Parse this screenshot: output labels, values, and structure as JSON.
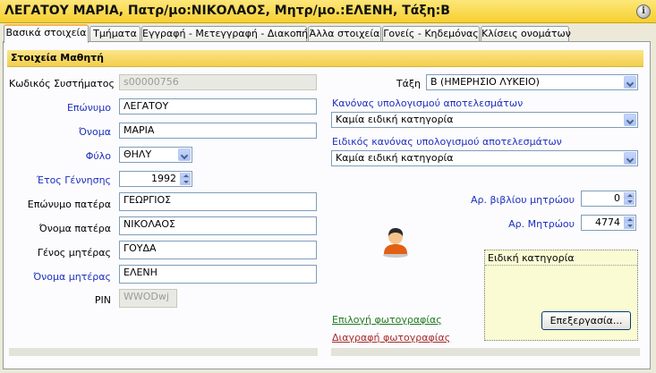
{
  "window": {
    "title": "ΛΕΓΑΤΟΥ ΜΑΡΙΑ, Πατρ/μο:ΝΙΚΟΛΑΟΣ, Μητρ/μο.:ΕΛΕΝΗ, Τάξη:Β",
    "info_icon": "info-icon"
  },
  "tabs": [
    {
      "label": "Βασικά στοιχεία",
      "active": true
    },
    {
      "label": "Τμήματα"
    },
    {
      "label": "Εγγραφή - Μετεγγραφή - Διακοπή"
    },
    {
      "label": "Άλλα στοιχεία"
    },
    {
      "label": "Γονείς - Κηδεμόνας"
    },
    {
      "label": "Κλίσεις ονομάτων"
    }
  ],
  "section": {
    "title": "Στοιχεία Μαθητή"
  },
  "form": {
    "system_code": {
      "label": "Κωδικός Συστήματος",
      "value": "s00000756"
    },
    "surname": {
      "label": "Επώνυμο",
      "value": "ΛΕΓΑΤΟΥ"
    },
    "name": {
      "label": "Όνομα",
      "value": "ΜΑΡΙΑ"
    },
    "gender": {
      "label": "Φύλο",
      "value": "ΘΗΛΥ"
    },
    "birth_year": {
      "label": "Έτος Γέννησης",
      "value": "1992"
    },
    "father_surname": {
      "label": "Επώνυμο πατέρα",
      "value": "ΓΕΩΡΓΙΟΣ"
    },
    "father_name": {
      "label": "Όνομα πατέρα",
      "value": "ΝΙΚΟΛΑΟΣ"
    },
    "mother_surname": {
      "label": "Γένος μητέρας",
      "value": "ΓΟΥΔΑ"
    },
    "mother_name": {
      "label": "Όνομα μητέρας",
      "value": "ΕΛΕΝΗ"
    },
    "pin": {
      "label": "PIN",
      "value": "WWODwj"
    }
  },
  "right": {
    "class": {
      "label": "Τάξη",
      "value": "Β  (ΗΜΕΡΗΣΙΟ ΛΥΚΕΙΟ)"
    },
    "calc_rule": {
      "label": "Κανόνας υπολογισμού αποτελεσμάτων",
      "value": "Καμία ειδική κατηγορία"
    },
    "special_calc_rule": {
      "label": "Ειδικός κανόνας υπολογισμού αποτελεσμάτων",
      "value": "Καμία ειδική κατηγορία"
    },
    "registry_book_no": {
      "label": "Αρ. βιβλίου μητρώου",
      "value": "0"
    },
    "registry_no": {
      "label": "Αρ. Μητρώου",
      "value": "4774"
    },
    "special_category": {
      "label": "Ειδική κατηγορία",
      "edit_button": "Επεξεργασία..."
    },
    "select_photo": "Επιλογή φωτογραφίας",
    "delete_photo": "Διαγραφή φωτογραφίας",
    "avatar_icon": "person-icon"
  },
  "colors": {
    "title_bar": "#f6cf2f",
    "label_blue": "#1c2fbd",
    "select_photo_link": "#217a21",
    "delete_photo_link": "#a52a2a"
  }
}
